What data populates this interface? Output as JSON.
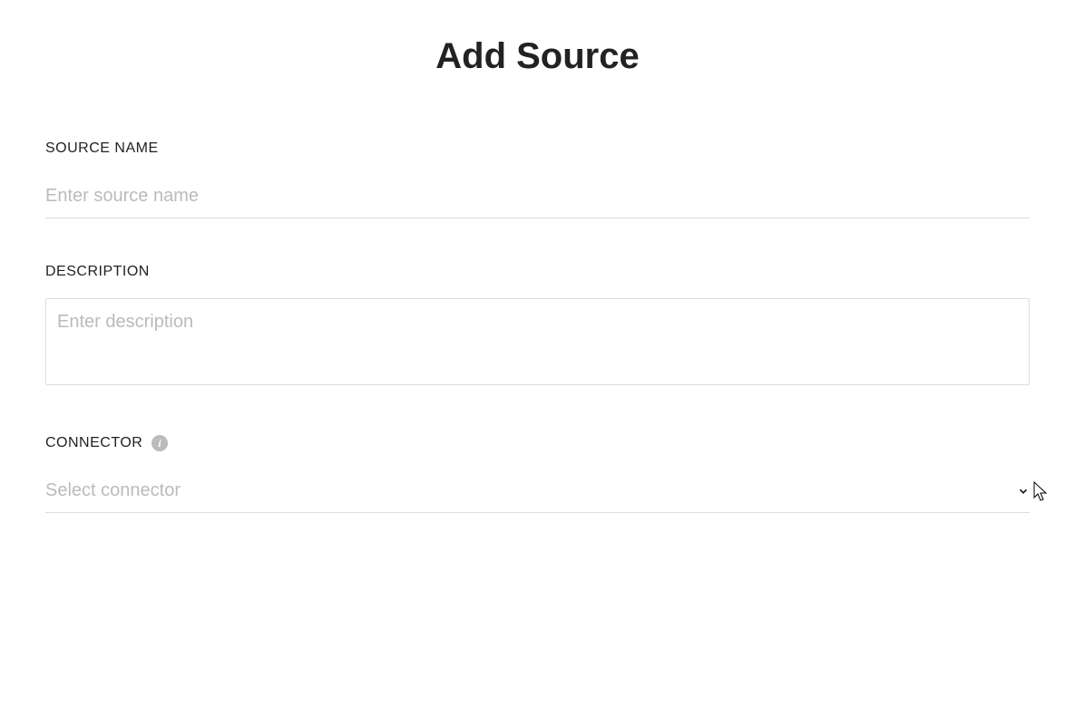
{
  "page": {
    "title": "Add Source"
  },
  "form": {
    "sourceName": {
      "label": "SOURCE NAME",
      "placeholder": "Enter source name",
      "value": ""
    },
    "description": {
      "label": "DESCRIPTION",
      "placeholder": "Enter description",
      "value": ""
    },
    "connector": {
      "label": "CONNECTOR",
      "placeholder": "Select connector",
      "value": ""
    }
  }
}
